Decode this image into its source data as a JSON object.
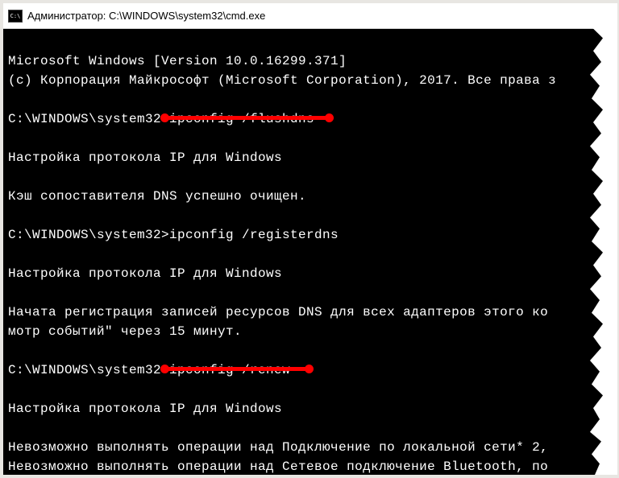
{
  "titlebar": {
    "icon_text": "C:\\",
    "title": "Администратор: C:\\WINDOWS\\system32\\cmd.exe"
  },
  "console": {
    "lines": [
      "Microsoft Windows [Version 10.0.16299.371]",
      "(c) Корпорация Майкрософт (Microsoft Corporation), 2017. Все права з",
      "",
      "C:\\WINDOWS\\system32>ipconfig /flushdns",
      "",
      "Настройка протокола IP для Windows",
      "",
      "Кэш сопоставителя DNS успешно очищен.",
      "",
      "C:\\WINDOWS\\system32>ipconfig /registerdns",
      "",
      "Настройка протокола IP для Windows",
      "",
      "Начата регистрация записей ресурсов DNS для всех адаптеров этого ко",
      "мотр событий\" через 15 минут.",
      "",
      "C:\\WINDOWS\\system32>ipconfig /renew",
      "",
      "Настройка протокола IP для Windows",
      "",
      "Невозможно выполнять операции над Подключение по локальной сети* 2,",
      "Невозможно выполнять операции над Сетевое подключение Bluetooth, по"
    ]
  },
  "annotations": {
    "underline1_target": "ipconfig /flushdns",
    "underline2_target": "ipconfig /renew"
  }
}
